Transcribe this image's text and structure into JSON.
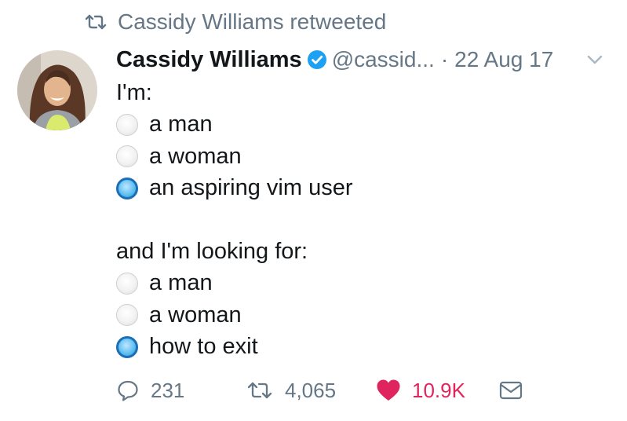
{
  "retweet": {
    "text": "Cassidy Williams retweeted",
    "icon": "retweet-icon"
  },
  "tweet": {
    "author_name": "Cassidy Williams",
    "handle": "@cassid...",
    "separator": "·",
    "date": "22 Aug 17",
    "verified": true,
    "lines": {
      "im": "I'm:",
      "opt1": "a man",
      "opt2": "a woman",
      "opt3": "an aspiring vim user",
      "looking": "and I'm looking for:",
      "opt4": "a man",
      "opt5": "a woman",
      "opt6": "how to exit"
    }
  },
  "actions": {
    "replies": "231",
    "retweets": "4,065",
    "likes": "10.9K"
  },
  "colors": {
    "secondary_text": "#657786",
    "verified_blue": "#1da1f2",
    "like_red": "#e0245e",
    "radio_selected": "#4db3ec"
  }
}
